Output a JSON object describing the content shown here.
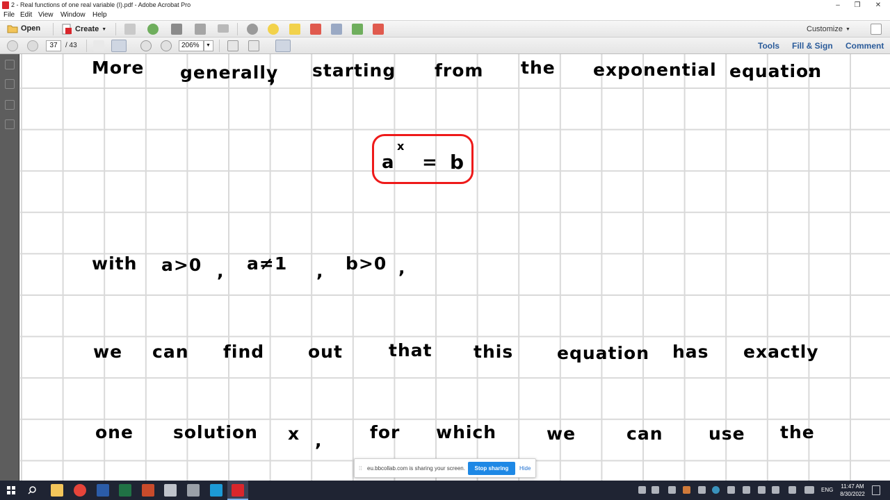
{
  "window": {
    "title": "2 - Real functions of one real variable (I).pdf - Adobe Acrobat Pro",
    "controls": [
      "–",
      "❐",
      "✕"
    ]
  },
  "menu": [
    "File",
    "Edit",
    "View",
    "Window",
    "Help"
  ],
  "toolbar": {
    "open_label": "Open",
    "create_label": "Create",
    "customize_label": "Customize"
  },
  "nav": {
    "current_page": "37",
    "total_pages": "/ 43",
    "zoom": "206%"
  },
  "panels": {
    "tools": "Tools",
    "fill_sign": "Fill & Sign",
    "comment": "Comment"
  },
  "document": {
    "lines": [
      [
        "More",
        "generally",
        ",",
        "starting",
        "from",
        "the",
        "exponential",
        "equation",
        ":"
      ],
      [
        "with",
        "a>0",
        ",",
        "a≠1",
        ",",
        "b>0",
        ","
      ],
      [
        "we",
        "can",
        "find",
        "out",
        "that",
        "this",
        "equation",
        "has",
        "exactly"
      ],
      [
        "one",
        "solution",
        "x",
        ",",
        "for",
        "which",
        "we",
        "can",
        "use",
        "the"
      ]
    ],
    "equation": {
      "base": "a",
      "exponent": "x",
      "equals": "=",
      "rhs": "b"
    },
    "grid_color": "#d9d9d9",
    "highlight_color": "#ee1a1a"
  },
  "share": {
    "message": "eu.bbcollab.com is sharing your screen.",
    "stop_label": "Stop sharing",
    "hide_label": "Hide"
  },
  "taskbar": {
    "language": "ENG",
    "time": "11:47 AM",
    "date": "8/30/2022"
  }
}
